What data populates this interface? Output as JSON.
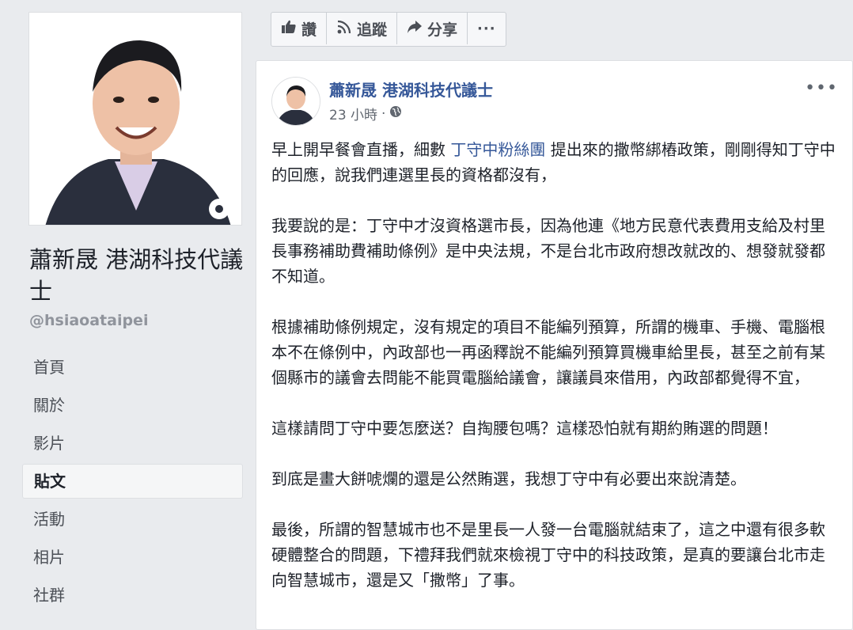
{
  "page": {
    "name": "蕭新晟 港湖科技代議士",
    "handle": "@hsiaoataipei"
  },
  "nav": {
    "items": [
      {
        "label": "首頁"
      },
      {
        "label": "關於"
      },
      {
        "label": "影片"
      },
      {
        "label": "貼文"
      },
      {
        "label": "活動"
      },
      {
        "label": "相片"
      },
      {
        "label": "社群"
      }
    ],
    "active_index": 3
  },
  "actions": {
    "like_label": "讚",
    "follow_label": "追蹤",
    "share_label": "分享",
    "more_label": "···"
  },
  "post": {
    "author": "蕭新晟 港湖科技代議士",
    "time": "23 小時",
    "separator": "·",
    "menu": "•••",
    "p1_a": "早上開早餐會直播，細數 ",
    "p1_tag": "丁守中粉絲團",
    "p1_b": " 提出來的撒幣綁樁政策，剛剛得知丁守中的回應，說我們連選里長的資格都沒有，",
    "p2": "我要說的是：丁守中才沒資格選市長，因為他連《地方民意代表費用支給及村里長事務補助費補助條例》是中央法規，不是台北市政府想改就改的、想發就發都不知道。",
    "p3": "根據補助條例規定，沒有規定的項目不能編列預算，所謂的機車、手機、電腦根本不在條例中，內政部也一再函釋說不能編列預算買機車給里長，甚至之前有某個縣市的議會去問能不能買電腦給議會，讓議員來借用，內政部都覺得不宜，",
    "p4": "這樣請問丁守中要怎麼送？自掏腰包嗎？這樣恐怕就有期約賄選的問題！",
    "p5": "到底是畫大餅唬爛的還是公然賄選，我想丁守中有必要出來說清楚。",
    "p6": "最後，所謂的智慧城市也不是里長一人發一台電腦就結束了，這之中還有很多軟硬體整合的問題，下禮拜我們就來檢視丁守中的科技政策，是真的要讓台北市走向智慧城市，還是又「撒幣」了事。"
  },
  "colors": {
    "link": "#365899",
    "background": "#e9ebee"
  }
}
